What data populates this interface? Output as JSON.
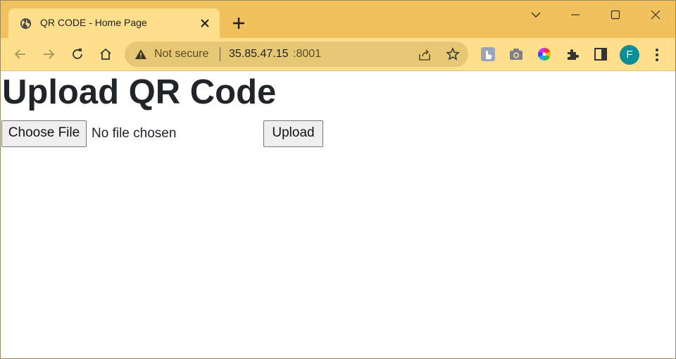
{
  "tab": {
    "title": "QR CODE - Home Page",
    "favicon": "globe-icon"
  },
  "address_bar": {
    "security_label": "Not secure",
    "host": "35.85.47.15",
    "port": ":8001"
  },
  "profile": {
    "initial": "F",
    "color": "#0b8f96"
  },
  "theme": {
    "tabstrip_color": "#f0c15c",
    "toolbar_color": "#fedf8b"
  },
  "page": {
    "heading": "Upload QR Code",
    "choose_file_label": "Choose File",
    "file_status": "No file chosen",
    "upload_label": "Upload"
  }
}
